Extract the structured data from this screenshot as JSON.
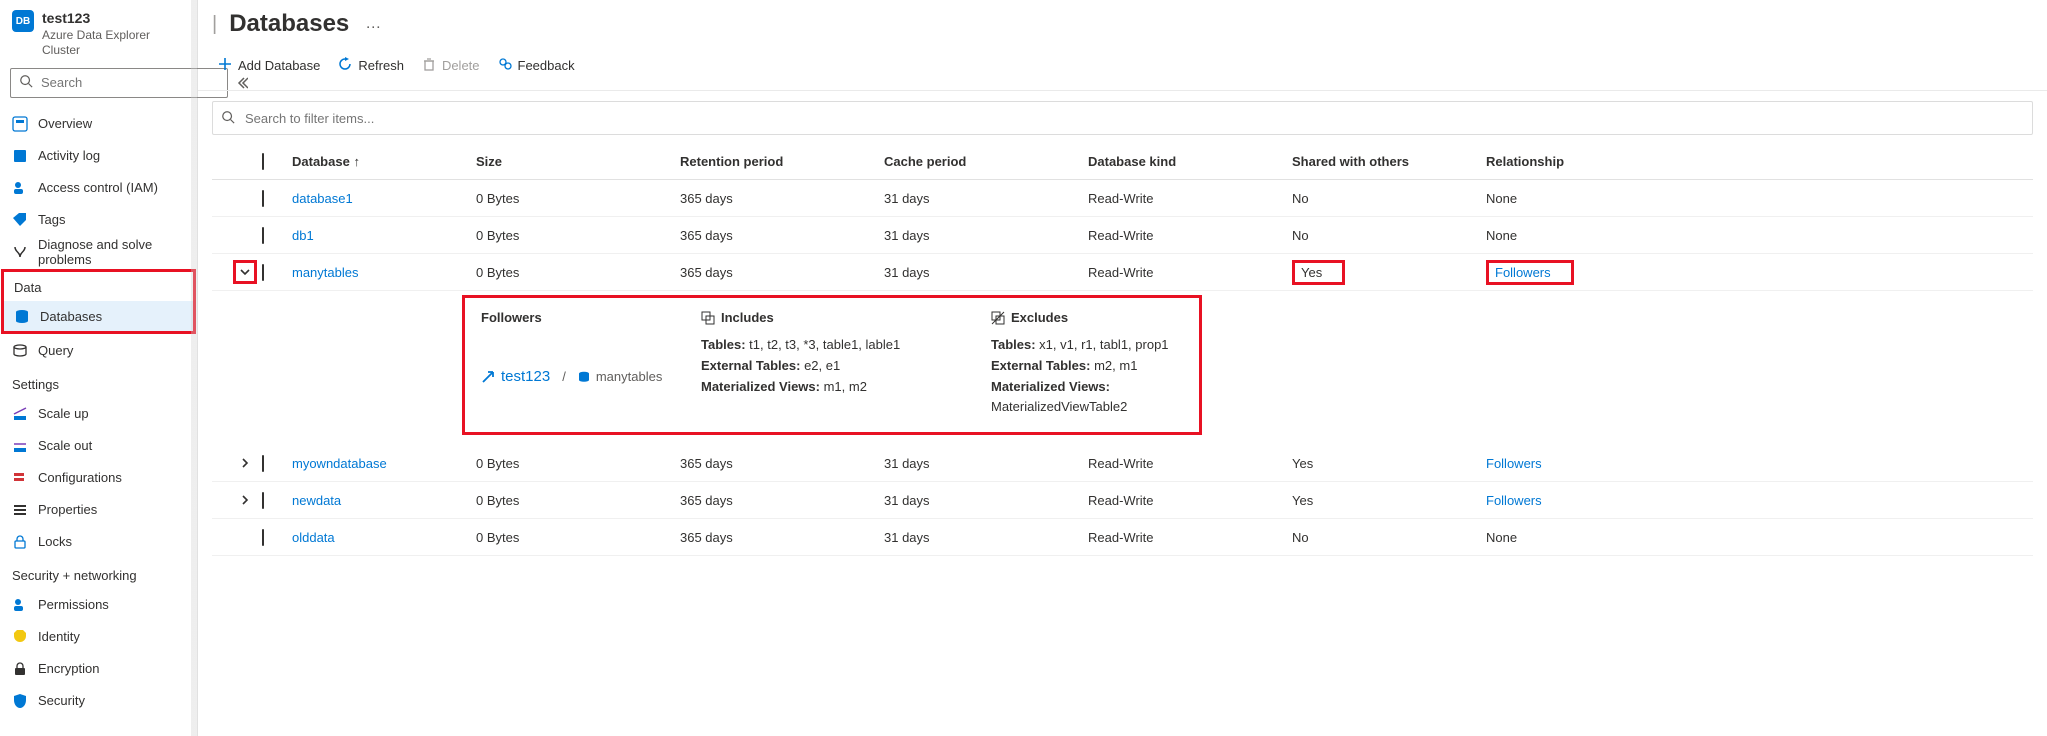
{
  "resource": {
    "name": "test123",
    "type": "Azure Data Explorer Cluster",
    "badge": "DB"
  },
  "sidebar": {
    "searchPlaceholder": "Search",
    "items": [
      {
        "label": "Overview"
      },
      {
        "label": "Activity log"
      },
      {
        "label": "Access control (IAM)"
      },
      {
        "label": "Tags"
      },
      {
        "label": "Diagnose and solve problems"
      }
    ],
    "dataTitle": "Data",
    "dataItems": [
      {
        "label": "Databases",
        "active": true
      },
      {
        "label": "Query"
      }
    ],
    "settingsTitle": "Settings",
    "settingsItems": [
      {
        "label": "Scale up"
      },
      {
        "label": "Scale out"
      },
      {
        "label": "Configurations"
      },
      {
        "label": "Properties"
      },
      {
        "label": "Locks"
      }
    ],
    "securityTitle": "Security + networking",
    "securityItems": [
      {
        "label": "Permissions"
      },
      {
        "label": "Identity"
      },
      {
        "label": "Encryption"
      },
      {
        "label": "Security"
      }
    ]
  },
  "page": {
    "title": "Databases",
    "dots": "…"
  },
  "toolbar": {
    "add": "Add Database",
    "refresh": "Refresh",
    "delete": "Delete",
    "feedback": "Feedback"
  },
  "filter": {
    "placeholder": "Search to filter items..."
  },
  "columns": {
    "database": "Database",
    "sortArrow": "↑",
    "size": "Size",
    "retention": "Retention period",
    "cache": "Cache period",
    "kind": "Database kind",
    "shared": "Shared with others",
    "relationship": "Relationship"
  },
  "rows": [
    {
      "name": "database1",
      "size": "0 Bytes",
      "retention": "365 days",
      "cache": "31 days",
      "kind": "Read-Write",
      "shared": "No",
      "relationship": "None",
      "relLink": false
    },
    {
      "name": "db1",
      "size": "0 Bytes",
      "retention": "365 days",
      "cache": "31 days",
      "kind": "Read-Write",
      "shared": "No",
      "relationship": "None",
      "relLink": false
    },
    {
      "name": "manytables",
      "size": "0 Bytes",
      "retention": "365 days",
      "cache": "31 days",
      "kind": "Read-Write",
      "shared": "Yes",
      "relationship": "Followers",
      "relLink": true,
      "expanded": true,
      "sharedHl": true,
      "relHl": true,
      "chevHl": true
    },
    {
      "name": "myowndatabase",
      "size": "0 Bytes",
      "retention": "365 days",
      "cache": "31 days",
      "kind": "Read-Write",
      "shared": "Yes",
      "relationship": "Followers",
      "relLink": true
    },
    {
      "name": "newdata",
      "size": "0 Bytes",
      "retention": "365 days",
      "cache": "31 days",
      "kind": "Read-Write",
      "shared": "Yes",
      "relationship": "Followers",
      "relLink": true
    },
    {
      "name": "olddata",
      "size": "0 Bytes",
      "retention": "365 days",
      "cache": "31 days",
      "kind": "Read-Write",
      "shared": "No",
      "relationship": "None",
      "relLink": false
    }
  ],
  "followersPanel": {
    "followersTitle": "Followers",
    "includesTitle": "Includes",
    "excludesTitle": "Excludes",
    "follower": {
      "cluster": "test123",
      "sep": "/",
      "db": "manytables"
    },
    "includes": {
      "tables": "t1, t2, t3, *3, table1, lable1",
      "external": "e2, e1",
      "matviews": "m1, m2"
    },
    "excludes": {
      "tables": "x1, v1, r1, tabl1, prop1",
      "external": "m2, m1",
      "matviews": "MaterializedViewTable2"
    },
    "labels": {
      "tables": "Tables:",
      "external": "External Tables:",
      "matviews": "Materialized Views:"
    }
  }
}
